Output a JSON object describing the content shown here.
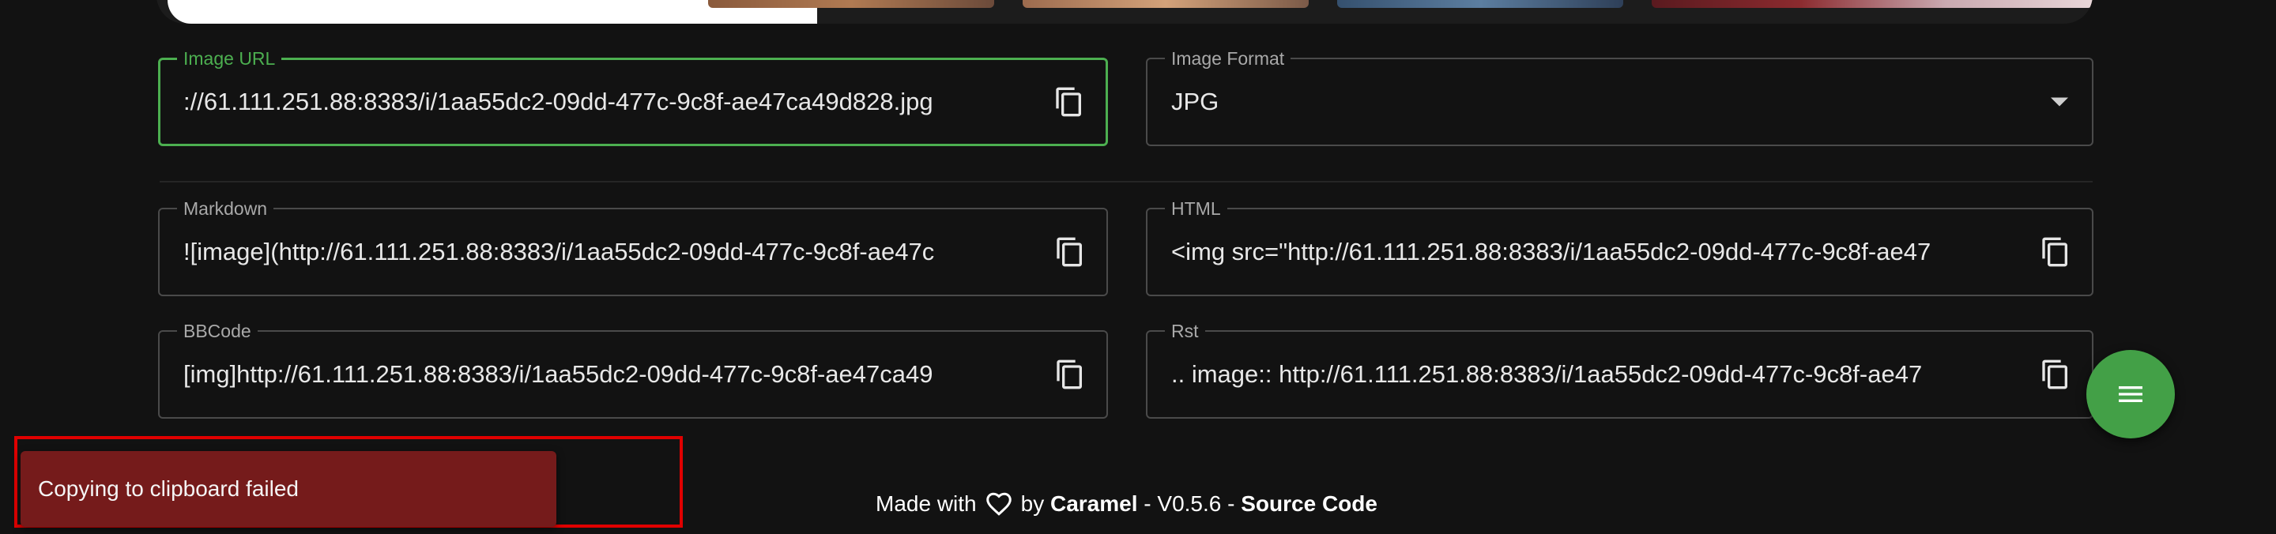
{
  "image_url": {
    "label": "Image URL",
    "value": "://61.111.251.88:8383/i/1aa55dc2-09dd-477c-9c8f-ae47ca49d828.jpg"
  },
  "image_format": {
    "label": "Image Format",
    "value": "JPG"
  },
  "markdown": {
    "label": "Markdown",
    "value": "![image](http://61.111.251.88:8383/i/1aa55dc2-09dd-477c-9c8f-ae47c"
  },
  "html": {
    "label": "HTML",
    "value": "<img src=\"http://61.111.251.88:8383/i/1aa55dc2-09dd-477c-9c8f-ae47"
  },
  "bbcode": {
    "label": "BBCode",
    "value": "[img]http://61.111.251.88:8383/i/1aa55dc2-09dd-477c-9c8f-ae47ca49"
  },
  "rst": {
    "label": "Rst",
    "value": ".. image:: http://61.111.251.88:8383/i/1aa55dc2-09dd-477c-9c8f-ae47"
  },
  "snackbar": {
    "message": "Copying to clipboard failed"
  },
  "footer": {
    "made_with": "Made with",
    "by": "by",
    "app_name": "Caramel",
    "separator1": "-",
    "version": "V0.5.6",
    "separator2": "-",
    "source_code": "Source Code"
  },
  "icons": {
    "copy": "copy-icon",
    "dropdown": "chevron-down-icon",
    "menu": "menu-icon",
    "heart": "heart-icon"
  },
  "colors": {
    "accent": "#4caf50",
    "fab": "#43a047",
    "snackbar": "#751b1b",
    "highlight": "#e00000",
    "background": "#121212"
  }
}
